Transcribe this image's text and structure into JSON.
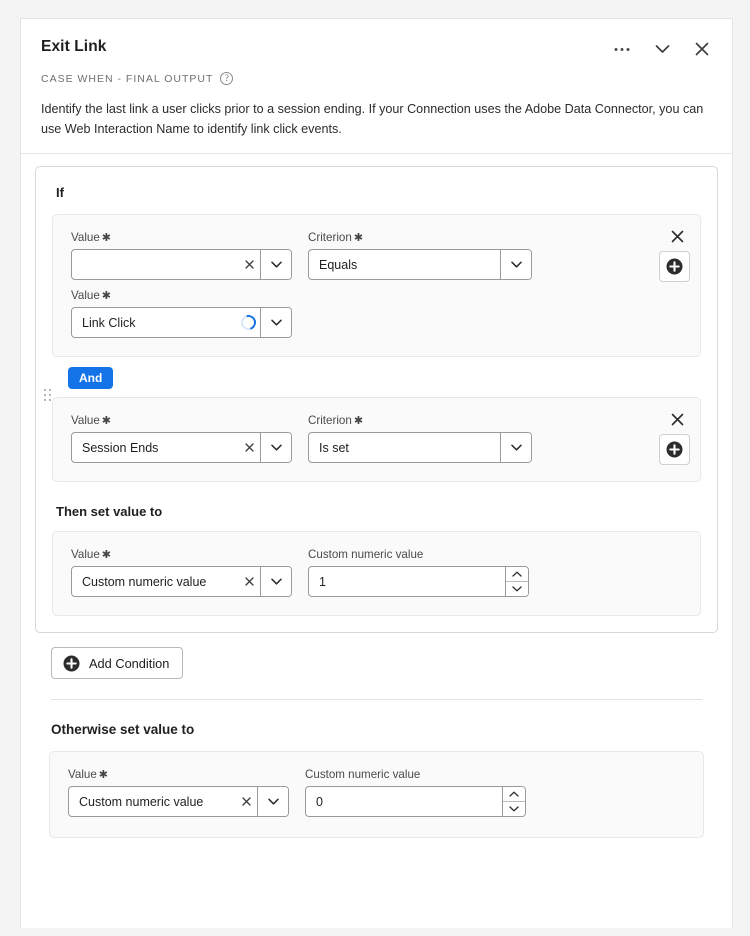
{
  "header": {
    "title": "Exit Link",
    "subtitle": "CASE WHEN - FINAL OUTPUT",
    "help_icon": "help-circle-icon",
    "more_icon": "ellipsis-icon",
    "collapse_icon": "chevron-down-icon",
    "close_icon": "close-icon",
    "description": "Identify the last link a user clicks prior to a session ending. If your Connection uses the Adobe Data Connector, you can use Web Interaction Name to identify link click events."
  },
  "sections": {
    "if_label": "If",
    "then_label": "Then set value to",
    "otherwise_label": "Otherwise set value to"
  },
  "labels": {
    "value": "Value",
    "criterion": "Criterion",
    "custom_numeric_value": "Custom numeric value",
    "required_mark": "✱"
  },
  "conditions": [
    {
      "value_field": {
        "text": "",
        "placeholder": "",
        "state": "empty",
        "clear_icon": "close-icon",
        "dropdown_icon": "chevron-down-icon"
      },
      "criterion_field": {
        "text": "Equals",
        "dropdown_icon": "chevron-down-icon"
      },
      "second_value_field": {
        "text": "Link Click",
        "state": "loading",
        "spinner_icon": "loading-spinner-icon",
        "dropdown_icon": "chevron-down-icon"
      },
      "remove_icon": "close-icon",
      "add_icon": "plus-circle-icon"
    },
    {
      "value_field": {
        "text": "Session Ends",
        "clear_icon": "close-icon",
        "dropdown_icon": "chevron-down-icon"
      },
      "criterion_field": {
        "text": "Is set",
        "dropdown_icon": "chevron-down-icon"
      },
      "remove_icon": "close-icon",
      "add_icon": "plus-circle-icon"
    }
  ],
  "operator_chip": {
    "label": "And",
    "color": "#1473e6"
  },
  "drag_handle": "drag-handle-icon",
  "then_block": {
    "value_field": {
      "text": "Custom numeric value",
      "clear_icon": "close-icon",
      "dropdown_icon": "chevron-down-icon"
    },
    "numeric_field": {
      "value": "1",
      "increment_icon": "chevron-up-icon",
      "decrement_icon": "chevron-down-icon"
    }
  },
  "otherwise_block": {
    "value_field": {
      "text": "Custom numeric value",
      "clear_icon": "close-icon",
      "dropdown_icon": "chevron-down-icon"
    },
    "numeric_field": {
      "value": "0",
      "increment_icon": "chevron-up-icon",
      "decrement_icon": "chevron-down-icon"
    }
  },
  "add_condition": {
    "label": "Add Condition",
    "icon": "plus-circle-icon"
  },
  "colors": {
    "accent": "#1473e6",
    "text": "#1f1f1f",
    "muted": "#707070",
    "panel_bg": "#fafafa",
    "page_bg": "#f4f4f4"
  }
}
